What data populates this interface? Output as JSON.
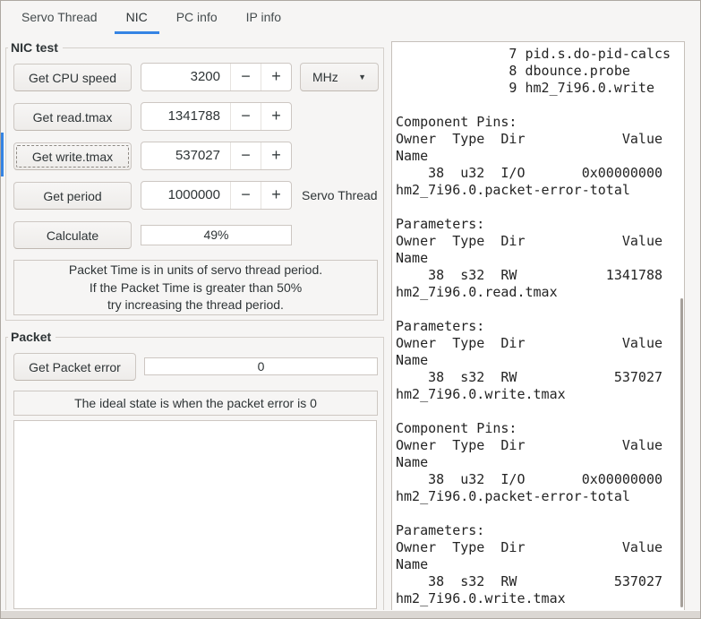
{
  "colors": {
    "accent": "#3584e4",
    "window_bg": "#f6f5f4",
    "text": "#2e3436",
    "panel_bg": "#ffffff"
  },
  "tabs": {
    "items": [
      {
        "label": "Servo Thread"
      },
      {
        "label": "NIC"
      },
      {
        "label": "PC info"
      },
      {
        "label": "IP info"
      }
    ],
    "active_index": 1
  },
  "spin": {
    "minus": "−",
    "plus": "+"
  },
  "combo_arrow": "▼",
  "nic_test": {
    "title": "NIC test",
    "rows": [
      {
        "button": "Get CPU speed",
        "value": "3200",
        "unit": "MHz"
      },
      {
        "button": "Get read.tmax",
        "value": "1341788"
      },
      {
        "button": "Get write.tmax",
        "value": "537027"
      },
      {
        "button": "Get period",
        "value": "1000000",
        "side_label": "Servo Thread"
      }
    ],
    "calculate_button": "Calculate",
    "percent_value": "49%",
    "note_lines": [
      "Packet Time is in units of servo thread period.",
      "If the Packet Time is greater than 50%",
      "try increasing the thread period."
    ]
  },
  "packet": {
    "title": "Packet",
    "button": "Get Packet error",
    "value": "0",
    "note": "The ideal state is when the packet error is 0"
  },
  "output": {
    "text": "              7 pid.s.do-pid-calcs\n              8 dbounce.probe\n              9 hm2_7i96.0.write\n\nComponent Pins:\nOwner  Type  Dir            Value\nName\n    38  u32  I/O       0x00000000\nhm2_7i96.0.packet-error-total\n\nParameters:\nOwner  Type  Dir            Value\nName\n    38  s32  RW           1341788\nhm2_7i96.0.read.tmax\n\nParameters:\nOwner  Type  Dir            Value\nName\n    38  s32  RW            537027\nhm2_7i96.0.write.tmax\n\nComponent Pins:\nOwner  Type  Dir            Value\nName\n    38  u32  I/O       0x00000000\nhm2_7i96.0.packet-error-total\n\nParameters:\nOwner  Type  Dir            Value\nName\n    38  s32  RW            537027\nhm2_7i96.0.write.tmax"
  }
}
